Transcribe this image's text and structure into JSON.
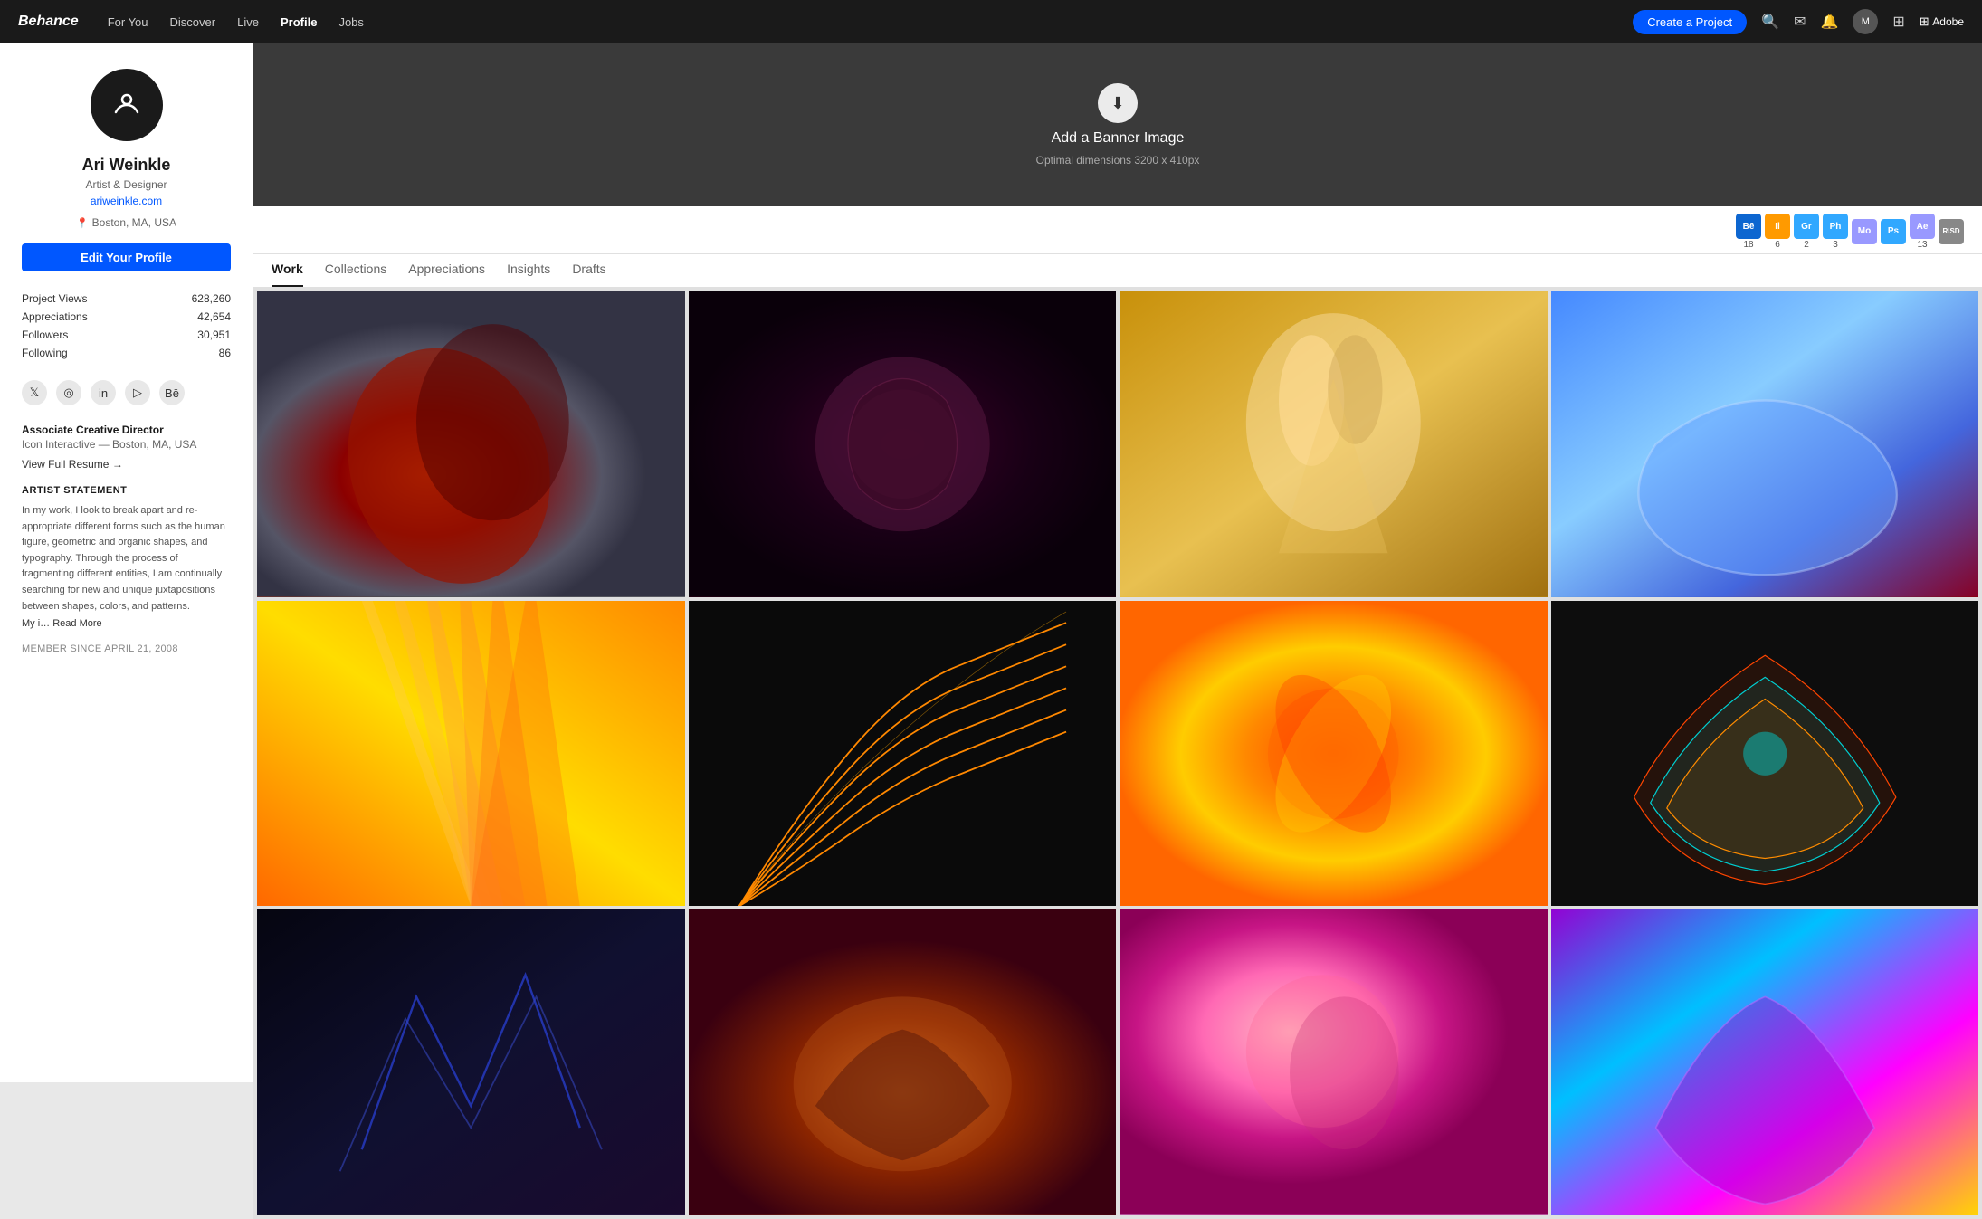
{
  "site": {
    "logo": "Behance"
  },
  "nav": {
    "links": [
      {
        "label": "For You",
        "active": false
      },
      {
        "label": "Discover",
        "active": false
      },
      {
        "label": "Live",
        "active": false
      },
      {
        "label": "Profile",
        "active": true
      },
      {
        "label": "Jobs",
        "active": false
      }
    ],
    "cta_label": "Create a Project",
    "icons": [
      "search-icon",
      "mail-icon",
      "bell-icon",
      "grid-icon"
    ],
    "adobe_label": "Adobe"
  },
  "banner": {
    "title": "Add a Banner Image",
    "subtitle": "Optimal dimensions 3200 x 410px"
  },
  "profile": {
    "name": "Ari Weinkle",
    "title": "Artist & Designer",
    "website": "ariweinkle.com",
    "location": "Boston, MA, USA",
    "edit_button": "Edit Your Profile",
    "stats": [
      {
        "label": "Project Views",
        "value": "628,260"
      },
      {
        "label": "Appreciations",
        "value": "42,654"
      },
      {
        "label": "Followers",
        "value": "30,951"
      },
      {
        "label": "Following",
        "value": "86"
      }
    ],
    "social_icons": [
      "twitter-icon",
      "dribbble-icon",
      "linkedin-icon",
      "vimeo-icon",
      "behance-icon"
    ],
    "job_title": "Associate Creative Director",
    "job_company": "Icon Interactive — Boston, MA, USA",
    "view_resume": "View Full Resume →",
    "artist_statement_heading": "ARTIST STATEMENT",
    "artist_statement": "In my work, I look to break apart and re-appropriate different forms such as the human figure, geometric and organic shapes, and typography. Through the process of fragmenting different entities, I am continually searching for new and unique juxtapositions between shapes, colors, and patterns.",
    "artist_statement_truncated": "My i…",
    "read_more": "Read More",
    "member_since": "MEMBER SINCE APRIL 21, 2008"
  },
  "adobe_badges": [
    {
      "label": "Bē",
      "count": "18",
      "color": "#0d66d0"
    },
    {
      "label": "Il",
      "count": "6",
      "color": "#ff9a00"
    },
    {
      "label": "Gr",
      "count": "2",
      "color": "#31a8ff"
    },
    {
      "label": "Ph",
      "count": "3",
      "color": "#31a8ff"
    },
    {
      "label": "Mo",
      "count": "",
      "color": "#9999ff"
    },
    {
      "label": "Ps",
      "count": "",
      "color": "#31a8ff"
    },
    {
      "label": "Ae",
      "count": "13",
      "color": "#9999ff"
    },
    {
      "label": "RISD",
      "count": "",
      "color": "#888"
    }
  ],
  "tabs": [
    {
      "label": "Work",
      "active": true
    },
    {
      "label": "Collections",
      "active": false
    },
    {
      "label": "Appreciations",
      "active": false
    },
    {
      "label": "Insights",
      "active": false
    },
    {
      "label": "Drafts",
      "active": false
    }
  ],
  "projects": [
    {
      "id": 1,
      "card_class": "card-1"
    },
    {
      "id": 2,
      "card_class": "card-2"
    },
    {
      "id": 3,
      "card_class": "card-3"
    },
    {
      "id": 4,
      "card_class": "card-4"
    },
    {
      "id": 5,
      "card_class": "card-5"
    },
    {
      "id": 6,
      "card_class": "card-6"
    },
    {
      "id": 7,
      "card_class": "card-7"
    },
    {
      "id": 8,
      "card_class": "card-8"
    },
    {
      "id": 9,
      "card_class": "card-9"
    },
    {
      "id": 10,
      "card_class": "card-10"
    },
    {
      "id": 11,
      "card_class": "card-11"
    },
    {
      "id": 12,
      "card_class": "card-12"
    }
  ]
}
